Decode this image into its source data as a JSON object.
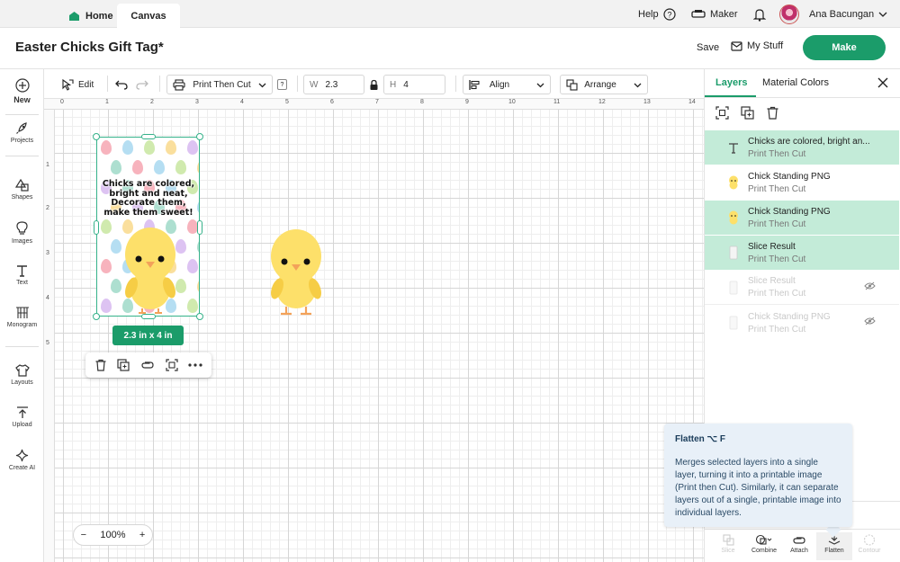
{
  "topbar": {
    "home_label": "Home",
    "canvas_label": "Canvas",
    "help_label": "Help",
    "maker_label": "Maker",
    "user_name": "Ana Bacungan"
  },
  "titlebar": {
    "project_title": "Easter Chicks Gift Tag*",
    "save_label": "Save",
    "mystuff_label": "My Stuff",
    "make_label": "Make"
  },
  "sidebar": {
    "items": [
      {
        "label": "New",
        "icon": "plus-icon"
      },
      {
        "label": "Projects",
        "icon": "rocket-icon"
      },
      {
        "label": "Shapes",
        "icon": "shapes-icon"
      },
      {
        "label": "Images",
        "icon": "lightbulb-icon"
      },
      {
        "label": "Text",
        "icon": "text-icon"
      },
      {
        "label": "Monogram",
        "icon": "monogram-icon"
      },
      {
        "label": "Layouts",
        "icon": "shirt-icon"
      },
      {
        "label": "Upload",
        "icon": "upload-icon"
      },
      {
        "label": "Create AI",
        "icon": "sparkle-icon"
      }
    ]
  },
  "toolbar": {
    "edit_label": "Edit",
    "operation_value": "Print Then Cut",
    "help_mark": "?",
    "w_label": "W",
    "w_value": "2.3",
    "h_label": "H",
    "h_value": "4",
    "align_label": "Align",
    "arrange_label": "Arrange"
  },
  "ruler": {
    "top": [
      "0",
      "1",
      "2",
      "3",
      "4",
      "5",
      "6",
      "7",
      "8",
      "9",
      "10",
      "11",
      "12",
      "13",
      "14"
    ],
    "left": [
      "1",
      "2",
      "3",
      "4",
      "5"
    ]
  },
  "design": {
    "tag_text": "Chicks are colored,\nbright and neat,\nDecorate them,\nmake them sweet!",
    "size_badge": "2.3  in x 4  in",
    "egg_colors": [
      "#f6a6b2",
      "#a8d8f0",
      "#c8e6a0",
      "#f9d98c",
      "#d7b8f0",
      "#9fd9c8"
    ],
    "chick_color": "#fde06a"
  },
  "zoom": {
    "minus": "−",
    "value": "100%",
    "plus": "+"
  },
  "panel": {
    "tab_layers": "Layers",
    "tab_material": "Material Colors",
    "layers": [
      {
        "name": "Chicks are colored, bright an...",
        "sub": "Print Then Cut",
        "selected": true,
        "hidden": false,
        "thumb": "text-icon"
      },
      {
        "name": "Chick Standing PNG",
        "sub": "Print Then Cut",
        "selected": false,
        "hidden": false,
        "thumb": "chick-icon"
      },
      {
        "name": "Chick Standing PNG",
        "sub": "Print Then Cut",
        "selected": true,
        "hidden": false,
        "thumb": "chick-icon"
      },
      {
        "name": "Slice Result",
        "sub": "Print Then Cut",
        "selected": true,
        "hidden": false,
        "thumb": "slice-icon"
      },
      {
        "name": "Slice Result",
        "sub": "Print Then Cut",
        "selected": false,
        "hidden": true,
        "thumb": "slice-icon"
      },
      {
        "name": "Chick Standing PNG",
        "sub": "Print Then Cut",
        "selected": false,
        "hidden": true,
        "thumb": "chick-icon"
      }
    ],
    "bottom_tools": [
      {
        "label": "Slice",
        "disabled": true
      },
      {
        "label": "Combine",
        "disabled": false
      },
      {
        "label": "Attach",
        "disabled": false
      },
      {
        "label": "Flatten",
        "disabled": false
      },
      {
        "label": "Contour",
        "disabled": true
      }
    ]
  },
  "tooltip": {
    "title": "Flatten ⌥ F",
    "body": "Merges selected layers into a single layer, turning it into a printable image (Print then Cut). Similarly, it can separate layers out of a single, printable image into individual layers."
  }
}
